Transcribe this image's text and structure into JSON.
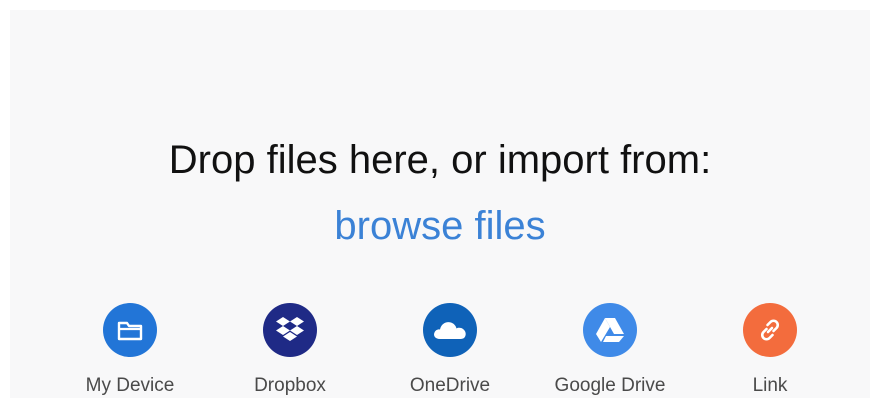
{
  "dropzone": {
    "headline": "Drop files here, or import from:",
    "browse_label": "browse files"
  },
  "providers": [
    {
      "label": "My Device",
      "icon": "folder-icon",
      "color": "#2275d7"
    },
    {
      "label": "Dropbox",
      "icon": "dropbox-icon",
      "color": "#1f2a86"
    },
    {
      "label": "OneDrive",
      "icon": "cloud-icon",
      "color": "#0f62b8"
    },
    {
      "label": "Google Drive",
      "icon": "google-drive-icon",
      "color": "#3f8ae8"
    },
    {
      "label": "Link",
      "icon": "link-icon",
      "color": "#f36c3d"
    }
  ]
}
